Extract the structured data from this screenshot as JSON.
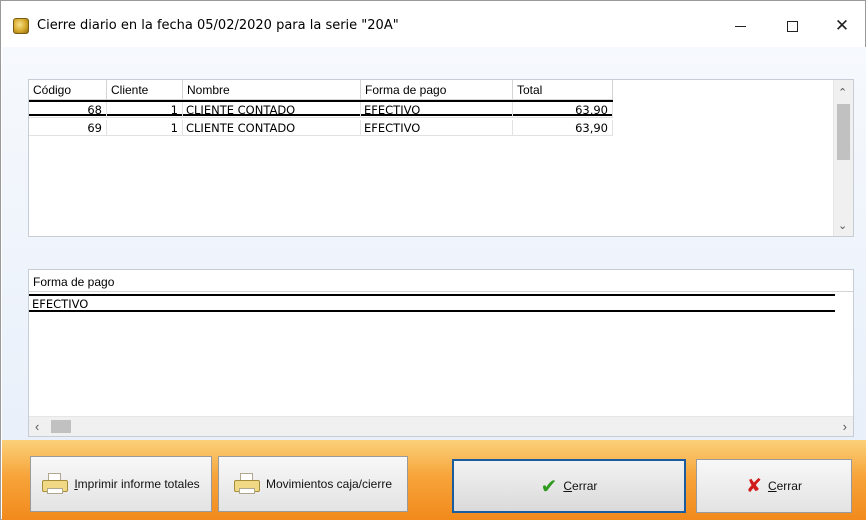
{
  "window": {
    "title": "Cierre diario en la fecha 05/02/2020 para la serie \"20A\"",
    "controls": {
      "minimize": "minimize-icon",
      "maximize": "maximize-icon",
      "close": "close-icon"
    }
  },
  "tickets_grid": {
    "columns": [
      "Código",
      "Cliente",
      "Nombre",
      "Forma de pago",
      "Total"
    ],
    "rows": [
      {
        "codigo": "68",
        "cliente": "1",
        "nombre": "CLIENTE CONTADO",
        "forma_pago": "EFECTIVO",
        "total": "63,90"
      },
      {
        "codigo": "69",
        "cliente": "1",
        "nombre": "CLIENTE CONTADO",
        "forma_pago": "EFECTIVO",
        "total": "63,90"
      }
    ],
    "selected_row": 0
  },
  "payment_grid": {
    "column": "Forma de pago",
    "rows": [
      "EFECTIVO"
    ]
  },
  "buttons": {
    "print_totals": {
      "label_underlined": "I",
      "label_rest": "mprimir informe totales",
      "icon": "printer-icon"
    },
    "movements": {
      "label": "Movimientos caja/cierre",
      "icon": "printer-icon"
    },
    "close_ok": {
      "label_underlined": "C",
      "label_rest": "errar",
      "icon": "check-icon"
    },
    "close_cancel": {
      "label_underlined": "C",
      "label_rest": "errar",
      "icon": "x-icon"
    }
  },
  "colors": {
    "footer_top": "#fbd17a",
    "footer_bottom": "#f28a1c",
    "default_button_border": "#1b5c9e",
    "check": "#2e9b1e",
    "cross": "#d11a1a"
  }
}
